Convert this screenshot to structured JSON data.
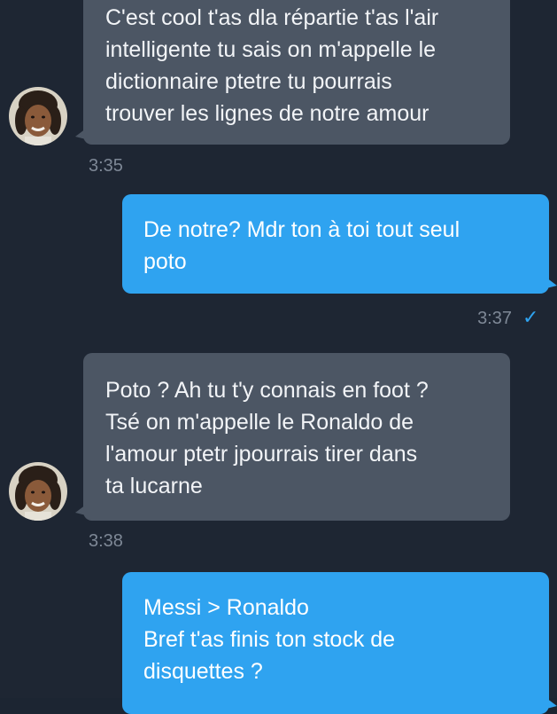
{
  "messages": [
    {
      "direction": "in",
      "lines": [
        "C'est cool t'as dla répartie t'as l'air",
        "intelligente tu sais on m'appelle le",
        "dictionnaire ptetre tu pourrais",
        "trouver les lignes de notre amour"
      ],
      "time": "3:35"
    },
    {
      "direction": "out",
      "lines": [
        "De notre? Mdr ton à toi tout seul",
        "poto"
      ],
      "time": "3:37",
      "status_icon": "✓"
    },
    {
      "direction": "in",
      "lines": [
        "Poto ? Ah tu t'y connais en foot ?",
        "Tsé on m'appelle le Ronaldo de",
        "l'amour ptetr jpourrais tirer dans",
        "ta lucarne"
      ],
      "time": "3:38"
    },
    {
      "direction": "out",
      "lines": [
        "Messi > Ronaldo",
        "Bref t'as finis ton stock de",
        "disquettes ?"
      ]
    }
  ],
  "colors": {
    "background": "#1e2633",
    "incoming_bubble": "#4c5664",
    "outgoing_bubble": "#2fa3f0",
    "timestamp": "#7e8896",
    "read_check": "#2fa3f0"
  },
  "icons": {
    "avatar": "contact-avatar",
    "read_status": "check-icon"
  }
}
